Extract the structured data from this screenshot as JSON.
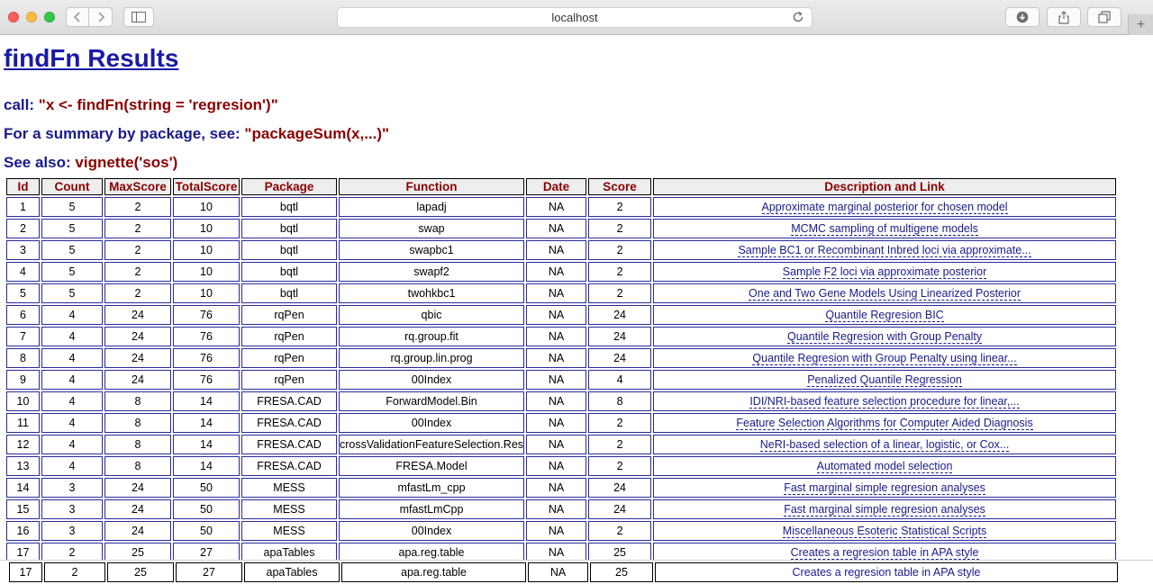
{
  "browser": {
    "url": "localhost",
    "new_tab_label": "+"
  },
  "page": {
    "title": "findFn Results",
    "call_label": "call:",
    "call_value": "\"x <- findFn(string = 'regresion')\"",
    "summary_label": "For a summary by package, see:",
    "summary_value": "\"packageSum(x,...)\"",
    "see_also_label": "See also:",
    "see_also_value": "vignette('sos')"
  },
  "table": {
    "headers": [
      "Id",
      "Count",
      "MaxScore",
      "TotalScore",
      "Package",
      "Function",
      "Date",
      "Score",
      "Description and Link"
    ],
    "rows": [
      [
        "1",
        "5",
        "2",
        "10",
        "bqtl",
        "lapadj",
        "NA",
        "2",
        "Approximate marginal posterior for chosen model"
      ],
      [
        "2",
        "5",
        "2",
        "10",
        "bqtl",
        "swap",
        "NA",
        "2",
        "MCMC sampling of multigene models"
      ],
      [
        "3",
        "5",
        "2",
        "10",
        "bqtl",
        "swapbc1",
        "NA",
        "2",
        "Sample BC1 or Recombinant Inbred loci via approximate..."
      ],
      [
        "4",
        "5",
        "2",
        "10",
        "bqtl",
        "swapf2",
        "NA",
        "2",
        "Sample F2 loci via approximate posterior"
      ],
      [
        "5",
        "5",
        "2",
        "10",
        "bqtl",
        "twohkbc1",
        "NA",
        "2",
        "One and Two Gene Models Using Linearized Posterior"
      ],
      [
        "6",
        "4",
        "24",
        "76",
        "rqPen",
        "qbic",
        "NA",
        "24",
        "Quantile Regresion BIC"
      ],
      [
        "7",
        "4",
        "24",
        "76",
        "rqPen",
        "rq.group.fit",
        "NA",
        "24",
        "Quantile Regresion with Group Penalty"
      ],
      [
        "8",
        "4",
        "24",
        "76",
        "rqPen",
        "rq.group.lin.prog",
        "NA",
        "24",
        "Quantile Regresion with Group Penalty using linear..."
      ],
      [
        "9",
        "4",
        "24",
        "76",
        "rqPen",
        "00Index",
        "NA",
        "4",
        "Penalized Quantile Regression"
      ],
      [
        "10",
        "4",
        "8",
        "14",
        "FRESA.CAD",
        "ForwardModel.Bin",
        "NA",
        "8",
        "IDI/NRI-based feature selection procedure for linear,..."
      ],
      [
        "11",
        "4",
        "8",
        "14",
        "FRESA.CAD",
        "00Index",
        "NA",
        "2",
        "Feature Selection Algorithms for Computer Aided Diagnosis"
      ],
      [
        "12",
        "4",
        "8",
        "14",
        "FRESA.CAD",
        "crossValidationFeatureSelection.Res",
        "NA",
        "2",
        "NeRI-based selection of a linear, logistic, or Cox..."
      ],
      [
        "13",
        "4",
        "8",
        "14",
        "FRESA.CAD",
        "FRESA.Model",
        "NA",
        "2",
        "Automated model selection"
      ],
      [
        "14",
        "3",
        "24",
        "50",
        "MESS",
        "mfastLm_cpp",
        "NA",
        "24",
        "Fast marginal simple regresion analyses"
      ],
      [
        "15",
        "3",
        "24",
        "50",
        "MESS",
        "mfastLmCpp",
        "NA",
        "24",
        "Fast marginal simple regresion analyses"
      ],
      [
        "16",
        "3",
        "24",
        "50",
        "MESS",
        "00Index",
        "NA",
        "2",
        "Miscellaneous Esoteric Statistical Scripts"
      ],
      [
        "17",
        "2",
        "25",
        "27",
        "apaTables",
        "apa.reg.table",
        "NA",
        "25",
        "Creates a regresion table in APA style"
      ]
    ],
    "sticky_row": [
      "17",
      "2",
      "25",
      "27",
      "apaTables",
      "apa.reg.table",
      "NA",
      "25",
      "Creates a regresion table in APA style"
    ]
  }
}
